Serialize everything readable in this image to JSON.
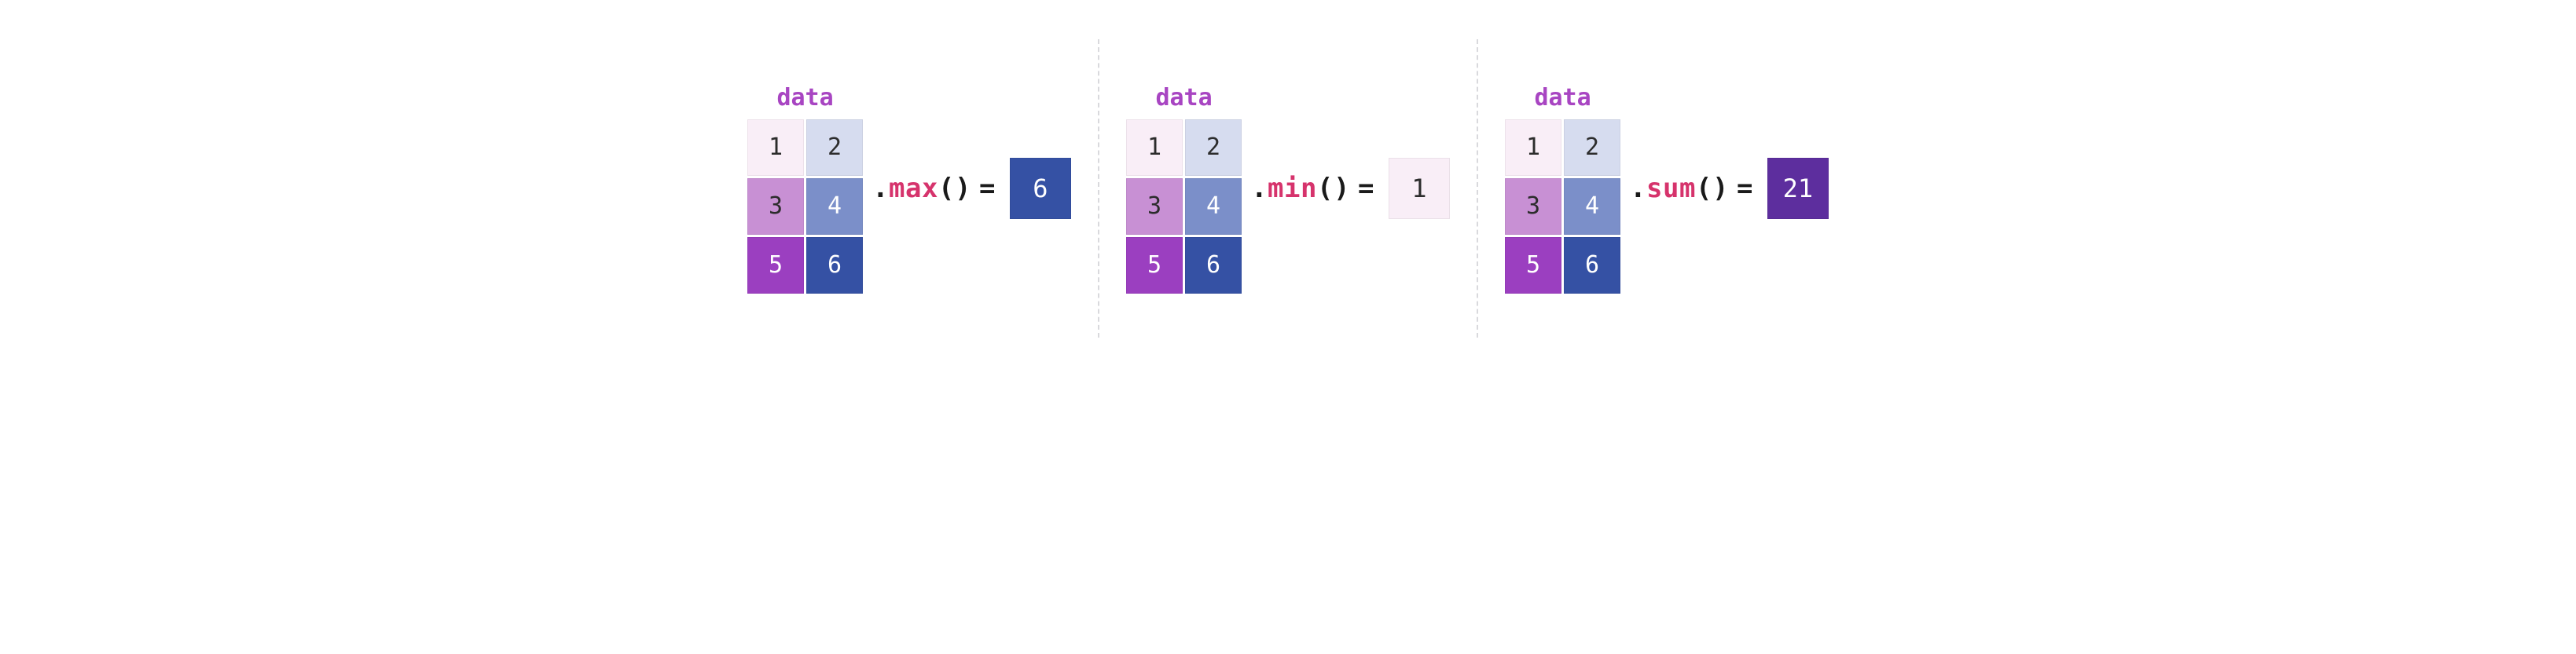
{
  "palette": {
    "title": "#a845c2",
    "fn": "#d6336c"
  },
  "cell_styles": {
    "1": {
      "bg": "#f9eef7",
      "fg": "#2c2c2c"
    },
    "2": {
      "bg": "#d6dcef",
      "fg": "#2c2c2c"
    },
    "3": {
      "bg": "#c890d4",
      "fg": "#2c2c2c"
    },
    "4": {
      "bg": "#7b8fc9",
      "fg": "#ffffff"
    },
    "5": {
      "bg": "#9b3fc0",
      "fg": "#ffffff"
    },
    "6": {
      "bg": "#3551a4",
      "fg": "#ffffff"
    }
  },
  "panels": [
    {
      "title": "data",
      "matrix": [
        [
          1,
          2
        ],
        [
          3,
          4
        ],
        [
          5,
          6
        ]
      ],
      "op": "max",
      "result": {
        "value": "6",
        "bg": "#3551a4",
        "fg": "#ffffff"
      }
    },
    {
      "title": "data",
      "matrix": [
        [
          1,
          2
        ],
        [
          3,
          4
        ],
        [
          5,
          6
        ]
      ],
      "op": "min",
      "result": {
        "value": "1",
        "bg": "#f9eef7",
        "fg": "#2c2c2c"
      }
    },
    {
      "title": "data",
      "matrix": [
        [
          1,
          2
        ],
        [
          3,
          4
        ],
        [
          5,
          6
        ]
      ],
      "op": "sum",
      "result": {
        "value": "21",
        "bg": "#5d2e9e",
        "fg": "#ffffff"
      }
    }
  ],
  "syntax": {
    "dot": ".",
    "open": "(",
    "close": ")",
    "eq": "="
  }
}
